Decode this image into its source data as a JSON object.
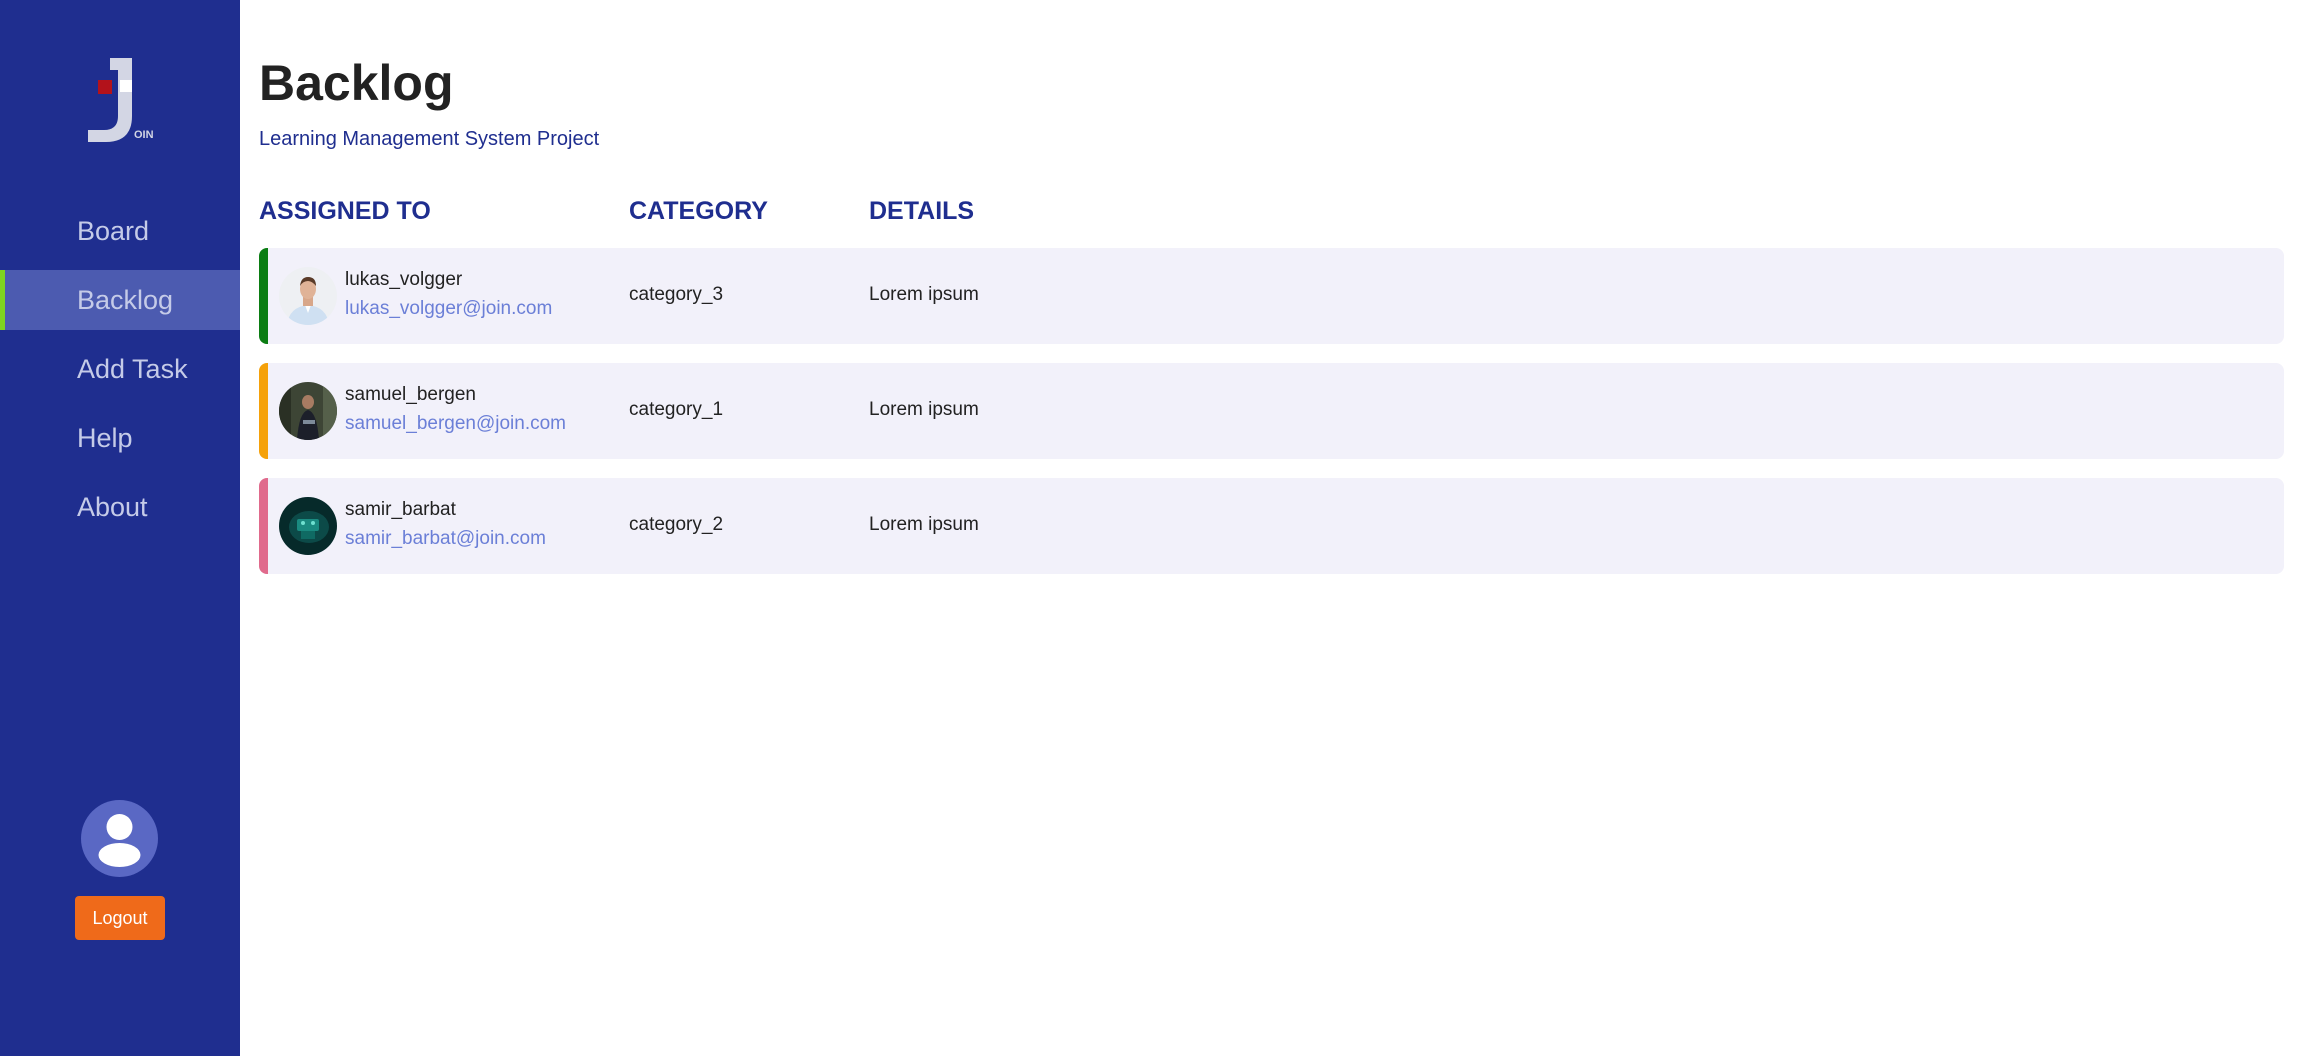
{
  "app": {
    "logo_text": "OIN"
  },
  "nav": {
    "items": [
      {
        "label": "Board"
      },
      {
        "label": "Backlog"
      },
      {
        "label": "Add Task"
      },
      {
        "label": "Help"
      },
      {
        "label": "About"
      }
    ],
    "active": "Backlog"
  },
  "user": {
    "avatar_icon": "user-icon",
    "logout_label": "Logout"
  },
  "page": {
    "title": "Backlog",
    "subtitle": "Learning Management System Project"
  },
  "table": {
    "headers": {
      "assigned_to": "ASSIGNED TO",
      "category": "CATEGORY",
      "details": "DETAILS"
    },
    "rows": [
      {
        "name": "lukas_volgger",
        "email": "lukas_volgger@join.com",
        "category": "category_3",
        "details": "Lorem ipsum",
        "color": "#0b7d13"
      },
      {
        "name": "samuel_bergen",
        "email": "samuel_bergen@join.com",
        "category": "category_1",
        "details": "Lorem ipsum",
        "color": "#f5a10a"
      },
      {
        "name": "samir_barbat",
        "email": "samir_barbat@join.com",
        "category": "category_2",
        "details": "Lorem ipsum",
        "color": "#e06a8c"
      }
    ]
  },
  "colors": {
    "sidebar": "#1f2e8f",
    "accent": "#7ed321",
    "logout": "#ef6a1a"
  }
}
